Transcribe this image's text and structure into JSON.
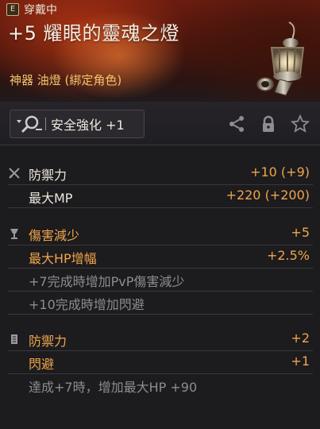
{
  "header": {
    "equip_badge": "E",
    "equip_status": "穿戴中",
    "title": "+5 耀眼的靈魂之燈",
    "item_type": "神器 油燈 (綁定角色)",
    "icon": "spirit-lamp-icon"
  },
  "actions": {
    "enhance_label": "安全強化 +1",
    "enhance_icon": "magnify-enhance-icon",
    "share_icon": "share-icon",
    "lock_icon": "lock-icon",
    "favorite_icon": "star-icon"
  },
  "stats": [
    {
      "label": "防禦力",
      "value": "+10 (+9)",
      "label_color": "white",
      "icon": "crossed-swords-icon"
    },
    {
      "label": "最大MP",
      "value": "+220 (+200)",
      "label_color": "white",
      "icon": ""
    }
  ],
  "effects": [
    {
      "label": "傷害減少",
      "value": "+5",
      "label_color": "orange",
      "icon": "goblet-icon"
    },
    {
      "label": "最大HP增幅",
      "value": "+2.5%",
      "label_color": "orange",
      "icon": ""
    },
    {
      "label": "+7完成時增加PvP傷害減少",
      "value": "",
      "label_color": "gray",
      "icon": ""
    },
    {
      "label": "+10完成時增加閃避",
      "value": "",
      "label_color": "gray",
      "icon": ""
    }
  ],
  "bonuses": [
    {
      "label": "防禦力",
      "value": "+2",
      "label_color": "orange",
      "icon": "scroll-icon"
    },
    {
      "label": "閃避",
      "value": "+1",
      "label_color": "orange",
      "icon": ""
    },
    {
      "label": "達成+7時，增加最大HP +90",
      "value": "",
      "label_color": "gray",
      "icon": ""
    }
  ],
  "colors": {
    "accent_orange": "#f0a54a",
    "type_gold": "#f0c56c",
    "gray_text": "#8e8b91"
  }
}
